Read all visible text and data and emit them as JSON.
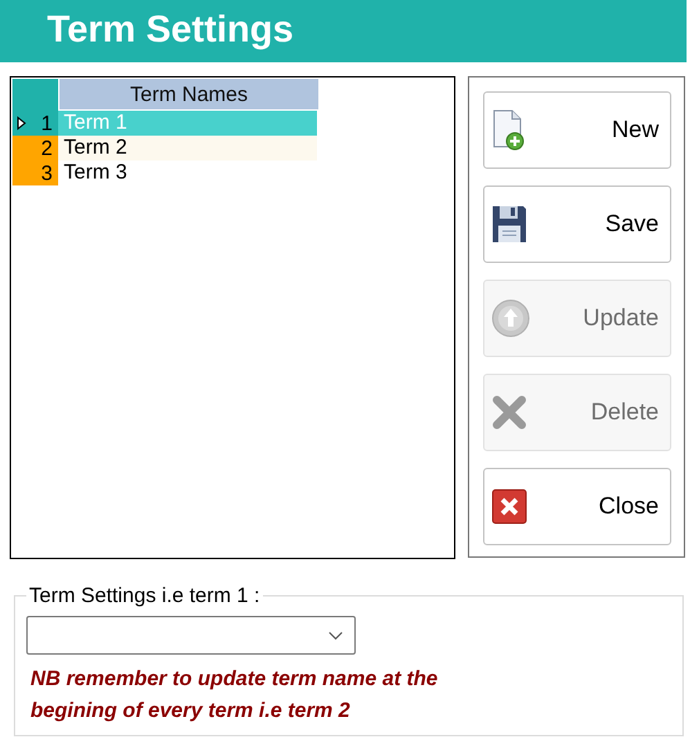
{
  "window": {
    "title": "Term Settings"
  },
  "grid": {
    "column": "Term Names",
    "rows": [
      {
        "number": "1",
        "name": "Term 1",
        "selected": true
      },
      {
        "number": "2",
        "name": "Term 2",
        "selected": false
      },
      {
        "number": "3",
        "name": "Term 3",
        "selected": false
      }
    ]
  },
  "buttons": [
    {
      "kind": "new",
      "label": "New",
      "disabled": false
    },
    {
      "kind": "save",
      "label": "Save",
      "disabled": false
    },
    {
      "kind": "update",
      "label": "Update",
      "disabled": true
    },
    {
      "kind": "delete",
      "label": "Delete",
      "disabled": true
    },
    {
      "kind": "close",
      "label": "Close",
      "disabled": false
    }
  ],
  "settings": {
    "legend": "Term Settings i.e term 1 :",
    "note": "NB remember to update term name at the begining of every term i.e term 2"
  }
}
